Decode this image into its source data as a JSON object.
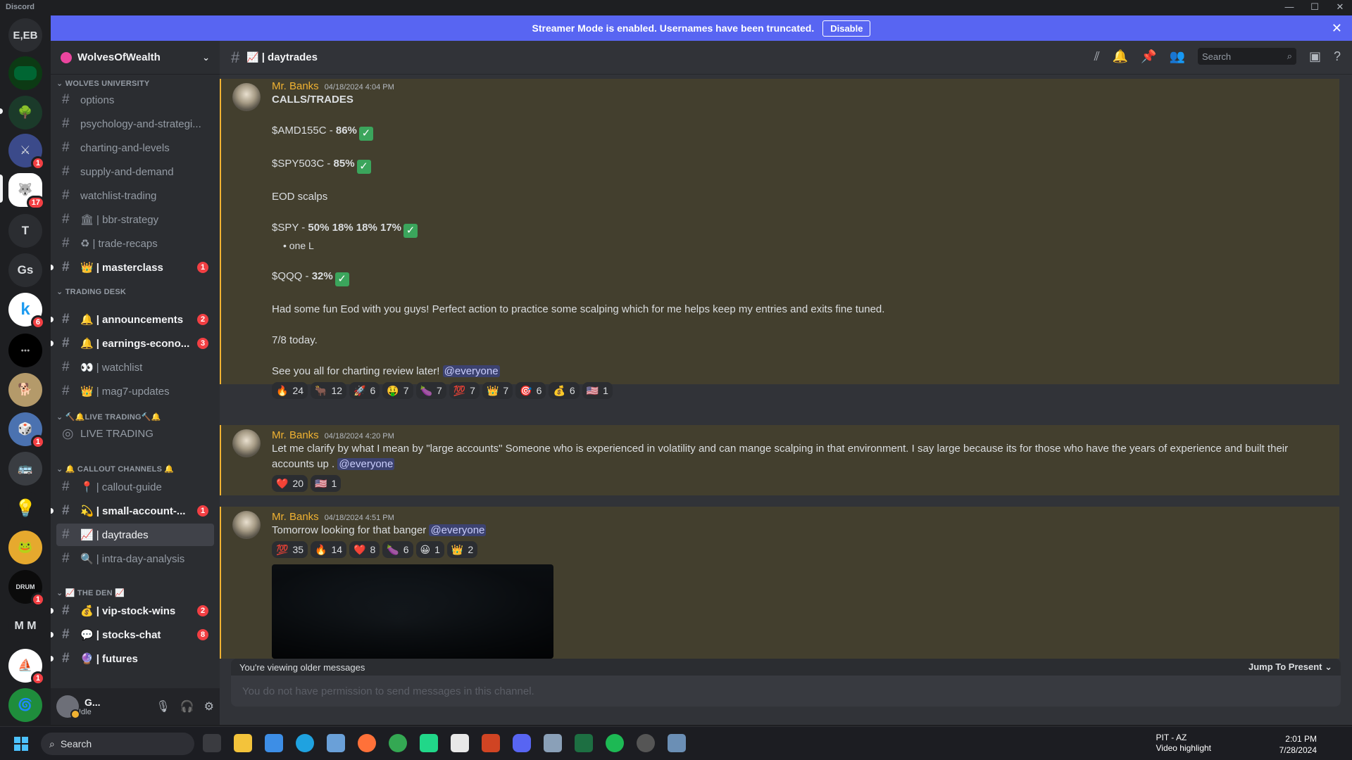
{
  "app": {
    "name": "Discord"
  },
  "banner": {
    "text": "Streamer Mode is enabled. Usernames have been truncated.",
    "button": "Disable"
  },
  "guilds": [
    {
      "label": "E,EB",
      "badge": ""
    },
    {
      "label": "",
      "badge": ""
    },
    {
      "label": "",
      "badge": ""
    },
    {
      "label": "",
      "badge": "1"
    },
    {
      "label": "",
      "badge": "17"
    },
    {
      "label": "T",
      "badge": ""
    },
    {
      "label": "Gs",
      "badge": ""
    },
    {
      "label": "k",
      "badge": "6"
    },
    {
      "label": "",
      "badge": ""
    },
    {
      "label": "",
      "badge": ""
    },
    {
      "label": "",
      "badge": "1"
    },
    {
      "label": "",
      "badge": ""
    },
    {
      "label": "",
      "badge": ""
    },
    {
      "label": "",
      "badge": ""
    },
    {
      "label": "",
      "badge": "1"
    },
    {
      "label": "M M",
      "badge": ""
    },
    {
      "label": "",
      "badge": "1"
    },
    {
      "label": "",
      "badge": ""
    }
  ],
  "server": {
    "name": "WolvesOfWealth"
  },
  "categories": {
    "wolves": "WOLVES UNIVERSITY",
    "trading": "TRADING DESK",
    "live": "🔨🔔LIVE TRADING🔨🔔",
    "callout": "🔔 CALLOUT CHANNELS 🔔",
    "den": "📈 THE DEN 📈"
  },
  "channels": {
    "options": {
      "name": "options"
    },
    "psych": {
      "name": "psychology-and-strategi..."
    },
    "charting": {
      "name": "charting-and-levels"
    },
    "supply": {
      "name": "supply-and-demand"
    },
    "watchlisttrading": {
      "name": "watchlist-trading"
    },
    "bbr": {
      "emoji": "🏛",
      "name": "| bbr-strategy"
    },
    "recaps": {
      "emoji": "♻",
      "name": "| trade-recaps"
    },
    "masterclass": {
      "emoji": "👑",
      "name": "| masterclass",
      "mention": "1"
    },
    "announcements": {
      "emoji": "🔔",
      "name": "| announcements",
      "mention": "2"
    },
    "earnings": {
      "emoji": "🔔",
      "name": "| earnings-econo...",
      "mention": "3"
    },
    "watchlist": {
      "emoji": "👀",
      "name": "| watchlist"
    },
    "mag7": {
      "emoji": "👑",
      "name": "| mag7-updates"
    },
    "livetrading": {
      "name": "LIVE TRADING"
    },
    "calloutguide": {
      "emoji": "📍",
      "name": "| callout-guide"
    },
    "smallaccount": {
      "emoji": "💫",
      "name": "| small-account-...",
      "mention": "1"
    },
    "daytrades": {
      "emoji": "📈",
      "name": "| daytrades"
    },
    "intraday": {
      "emoji": "🔍",
      "name": "| intra-day-analysis"
    },
    "vipwins": {
      "emoji": "💰",
      "name": "| vip-stock-wins",
      "mention": "2"
    },
    "stockschat": {
      "emoji": "💬",
      "name": "| stocks-chat",
      "mention": "8"
    },
    "futures": {
      "emoji": "🔮",
      "name": "| futures"
    }
  },
  "user": {
    "name": "G...",
    "status": "Idle"
  },
  "header": {
    "channel": "| daytrades",
    "channel_emoji": "📈",
    "search_placeholder": "Search"
  },
  "messages": [
    {
      "author": "Mr. Banks",
      "timestamp": "04/18/2024 4:04 PM",
      "title": "CALLS/TRADES",
      "l1a": "$AMD155C - ",
      "l1b": "86%",
      "l2a": "$SPY503C - ",
      "l2b": "85%",
      "l3": "EOD scalps",
      "l4a": "$SPY - ",
      "l4b": "50% 18% 18% 17%",
      "bullet": "one L",
      "l5a": "$QQQ - ",
      "l5b": "32%",
      "l6": "Had some fun Eod with you guys! Perfect action to practice some scalping which for me helps keep my entries and exits fine tuned.",
      "l7": "7/8 today.",
      "l8": "See you all for charting review later! ",
      "mention": "@everyone",
      "reactions": [
        {
          "e": "🔥",
          "c": "24"
        },
        {
          "e": "🐂",
          "c": "12"
        },
        {
          "e": "🚀",
          "c": "6"
        },
        {
          "e": "🤑",
          "c": "7"
        },
        {
          "e": "🍆",
          "c": "7"
        },
        {
          "e": "💯",
          "c": "7"
        },
        {
          "e": "👑",
          "c": "7"
        },
        {
          "e": "🎯",
          "c": "6"
        },
        {
          "e": "💰",
          "c": "6"
        },
        {
          "e": "🇺🇸",
          "c": "1"
        }
      ]
    },
    {
      "author": "Mr. Banks",
      "timestamp": "04/18/2024 4:20 PM",
      "text": "Let me clarify by what I mean by \"large accounts\" Someone who is experienced in volatility and can mange scalping in that environment. I say large because its for those who have the years of experience and built their accounts up . ",
      "mention": "@everyone",
      "reactions": [
        {
          "e": "❤️",
          "c": "20"
        },
        {
          "e": "🇺🇸",
          "c": "1"
        }
      ]
    },
    {
      "author": "Mr. Banks",
      "timestamp": "04/18/2024 4:51 PM",
      "text": "Tomorrow looking for that banger ",
      "mention": "@everyone",
      "reactions": [
        {
          "e": "💯",
          "c": "35"
        },
        {
          "e": "🔥",
          "c": "14"
        },
        {
          "e": "❤️",
          "c": "8"
        },
        {
          "e": "🍆",
          "c": "6"
        },
        {
          "e": "😀",
          "c": "1"
        },
        {
          "e": "👑",
          "c": "2"
        }
      ]
    }
  ],
  "older": {
    "text": "You're viewing older messages",
    "jump": "Jump To Present"
  },
  "composer": {
    "placeholder": "You do not have permission to send messages in this channel."
  },
  "taskbar": {
    "search": "Search",
    "tray_title": "PIT - AZ",
    "tray_sub": "Video highlight",
    "time": "2:01 PM",
    "date": "7/28/2024"
  }
}
